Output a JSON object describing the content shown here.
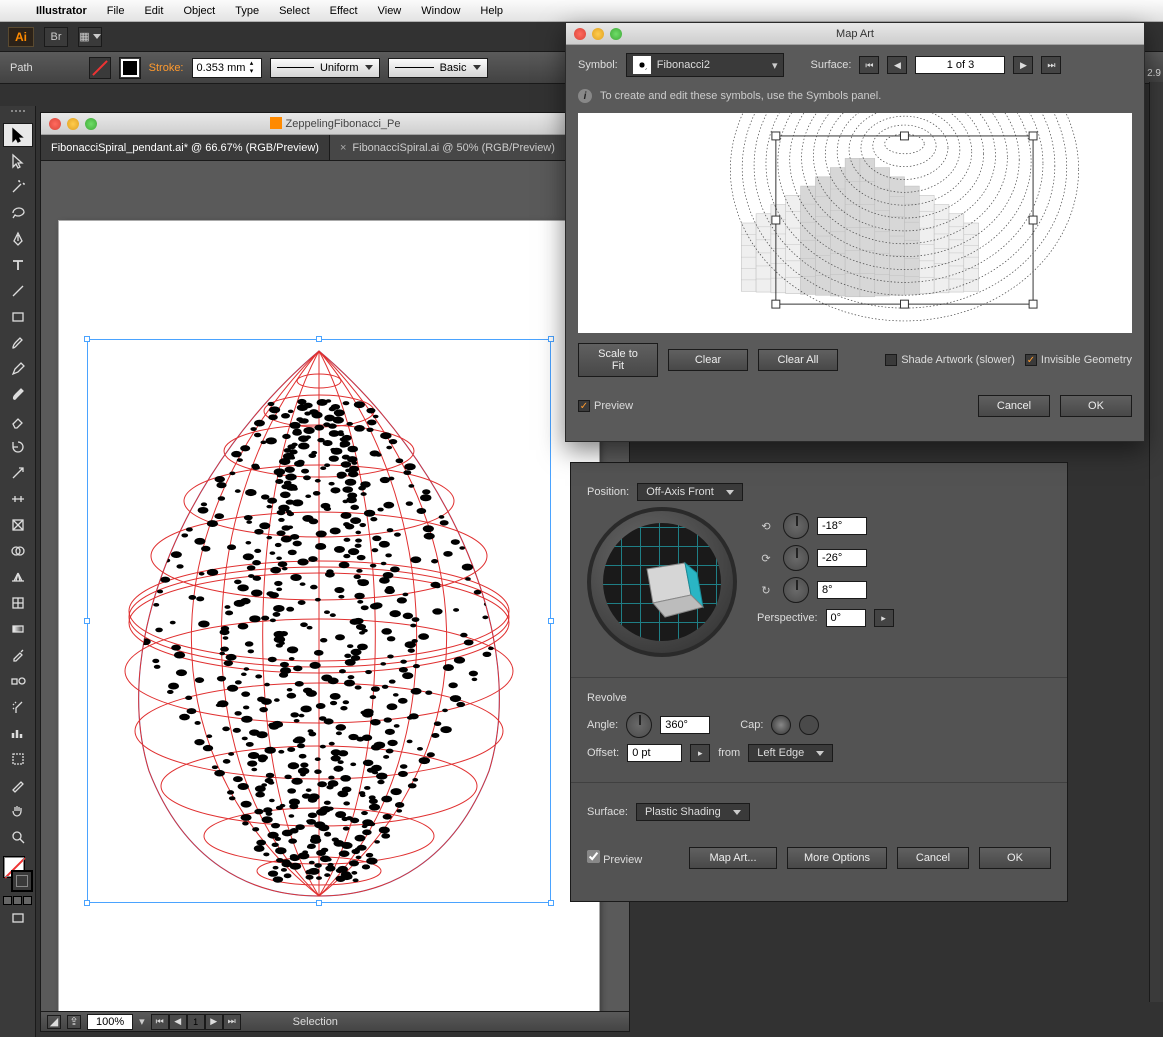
{
  "menubar": {
    "app": "Illustrator",
    "items": [
      "File",
      "Edit",
      "Object",
      "Type",
      "Select",
      "Effect",
      "View",
      "Window",
      "Help"
    ]
  },
  "topbar": {
    "badge": "Ai",
    "br_label": "Br"
  },
  "controlbar": {
    "path_label": "Path",
    "stroke_label": "Stroke:",
    "stroke_value": "0.353 mm",
    "profile_uniform": "Uniform",
    "brush_basic": "Basic"
  },
  "document": {
    "title": "ZeppelingFibonacci_Pe",
    "tabs": [
      {
        "label": "FibonacciSpiral_pendant.ai* @ 66.67% (RGB/Preview)",
        "active": true
      },
      {
        "label": "FibonacciSpiral.ai @ 50% (RGB/Preview)",
        "active": false
      }
    ],
    "zoom": "100%",
    "page": "1",
    "status": "Selection"
  },
  "tools": [
    "selection",
    "direct-selection",
    "magic-wand",
    "lasso",
    "pen",
    "type",
    "line",
    "rectangle",
    "paintbrush",
    "pencil",
    "blob-brush",
    "eraser",
    "rotate",
    "scale",
    "width",
    "free-transform",
    "shape-builder",
    "perspective-grid",
    "mesh",
    "gradient",
    "eyedropper",
    "blend",
    "symbol-sprayer",
    "column-graph",
    "artboard",
    "slice",
    "hand",
    "zoom"
  ],
  "revolve": {
    "position_label": "Position:",
    "position_value": "Off-Axis Front",
    "rot_x": "-18°",
    "rot_y": "-26°",
    "rot_z": "8°",
    "perspective_label": "Perspective:",
    "perspective_value": "0°",
    "section_label": "Revolve",
    "angle_label": "Angle:",
    "angle_value": "360°",
    "cap_label": "Cap:",
    "offset_label": "Offset:",
    "offset_value": "0 pt",
    "from_label": "from",
    "from_value": "Left Edge",
    "surface_label": "Surface:",
    "surface_value": "Plastic Shading",
    "preview_label": "Preview",
    "mapart_btn": "Map Art...",
    "more_btn": "More Options",
    "cancel_btn": "Cancel",
    "ok_btn": "OK"
  },
  "mapart": {
    "title": "Map Art",
    "symbol_label": "Symbol:",
    "symbol_value": "Fibonacci2",
    "surface_label": "Surface:",
    "surface_value": "1 of 3",
    "info_text": "To create and edit these symbols, use the Symbols panel.",
    "scale_btn": "Scale to Fit",
    "clear_btn": "Clear",
    "clearall_btn": "Clear All",
    "shade_label": "Shade Artwork (slower)",
    "invisible_label": "Invisible Geometry",
    "preview_label": "Preview",
    "cancel_btn": "Cancel",
    "ok_btn": "OK"
  },
  "right_edge": "2.9"
}
